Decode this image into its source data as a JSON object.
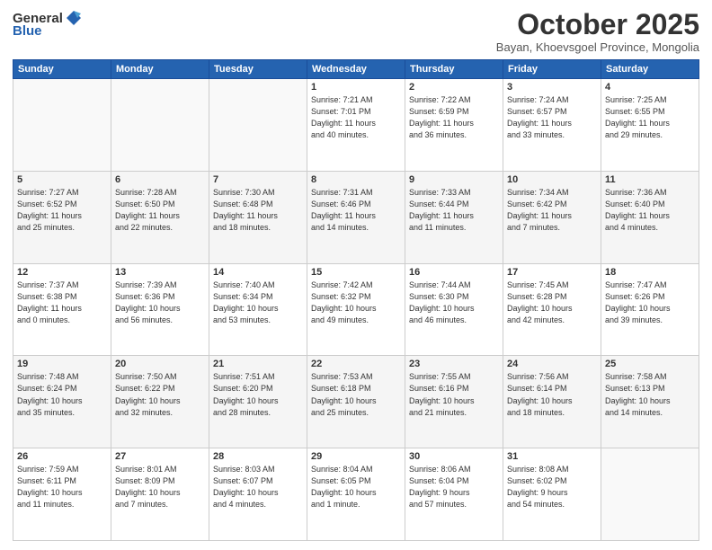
{
  "header": {
    "logo_general": "General",
    "logo_blue": "Blue",
    "month_title": "October 2025",
    "subtitle": "Bayan, Khoevsgoel Province, Mongolia"
  },
  "weekdays": [
    "Sunday",
    "Monday",
    "Tuesday",
    "Wednesday",
    "Thursday",
    "Friday",
    "Saturday"
  ],
  "weeks": [
    [
      {
        "day": "",
        "text": ""
      },
      {
        "day": "",
        "text": ""
      },
      {
        "day": "",
        "text": ""
      },
      {
        "day": "1",
        "text": "Sunrise: 7:21 AM\nSunset: 7:01 PM\nDaylight: 11 hours\nand 40 minutes."
      },
      {
        "day": "2",
        "text": "Sunrise: 7:22 AM\nSunset: 6:59 PM\nDaylight: 11 hours\nand 36 minutes."
      },
      {
        "day": "3",
        "text": "Sunrise: 7:24 AM\nSunset: 6:57 PM\nDaylight: 11 hours\nand 33 minutes."
      },
      {
        "day": "4",
        "text": "Sunrise: 7:25 AM\nSunset: 6:55 PM\nDaylight: 11 hours\nand 29 minutes."
      }
    ],
    [
      {
        "day": "5",
        "text": "Sunrise: 7:27 AM\nSunset: 6:52 PM\nDaylight: 11 hours\nand 25 minutes."
      },
      {
        "day": "6",
        "text": "Sunrise: 7:28 AM\nSunset: 6:50 PM\nDaylight: 11 hours\nand 22 minutes."
      },
      {
        "day": "7",
        "text": "Sunrise: 7:30 AM\nSunset: 6:48 PM\nDaylight: 11 hours\nand 18 minutes."
      },
      {
        "day": "8",
        "text": "Sunrise: 7:31 AM\nSunset: 6:46 PM\nDaylight: 11 hours\nand 14 minutes."
      },
      {
        "day": "9",
        "text": "Sunrise: 7:33 AM\nSunset: 6:44 PM\nDaylight: 11 hours\nand 11 minutes."
      },
      {
        "day": "10",
        "text": "Sunrise: 7:34 AM\nSunset: 6:42 PM\nDaylight: 11 hours\nand 7 minutes."
      },
      {
        "day": "11",
        "text": "Sunrise: 7:36 AM\nSunset: 6:40 PM\nDaylight: 11 hours\nand 4 minutes."
      }
    ],
    [
      {
        "day": "12",
        "text": "Sunrise: 7:37 AM\nSunset: 6:38 PM\nDaylight: 11 hours\nand 0 minutes."
      },
      {
        "day": "13",
        "text": "Sunrise: 7:39 AM\nSunset: 6:36 PM\nDaylight: 10 hours\nand 56 minutes."
      },
      {
        "day": "14",
        "text": "Sunrise: 7:40 AM\nSunset: 6:34 PM\nDaylight: 10 hours\nand 53 minutes."
      },
      {
        "day": "15",
        "text": "Sunrise: 7:42 AM\nSunset: 6:32 PM\nDaylight: 10 hours\nand 49 minutes."
      },
      {
        "day": "16",
        "text": "Sunrise: 7:44 AM\nSunset: 6:30 PM\nDaylight: 10 hours\nand 46 minutes."
      },
      {
        "day": "17",
        "text": "Sunrise: 7:45 AM\nSunset: 6:28 PM\nDaylight: 10 hours\nand 42 minutes."
      },
      {
        "day": "18",
        "text": "Sunrise: 7:47 AM\nSunset: 6:26 PM\nDaylight: 10 hours\nand 39 minutes."
      }
    ],
    [
      {
        "day": "19",
        "text": "Sunrise: 7:48 AM\nSunset: 6:24 PM\nDaylight: 10 hours\nand 35 minutes."
      },
      {
        "day": "20",
        "text": "Sunrise: 7:50 AM\nSunset: 6:22 PM\nDaylight: 10 hours\nand 32 minutes."
      },
      {
        "day": "21",
        "text": "Sunrise: 7:51 AM\nSunset: 6:20 PM\nDaylight: 10 hours\nand 28 minutes."
      },
      {
        "day": "22",
        "text": "Sunrise: 7:53 AM\nSunset: 6:18 PM\nDaylight: 10 hours\nand 25 minutes."
      },
      {
        "day": "23",
        "text": "Sunrise: 7:55 AM\nSunset: 6:16 PM\nDaylight: 10 hours\nand 21 minutes."
      },
      {
        "day": "24",
        "text": "Sunrise: 7:56 AM\nSunset: 6:14 PM\nDaylight: 10 hours\nand 18 minutes."
      },
      {
        "day": "25",
        "text": "Sunrise: 7:58 AM\nSunset: 6:13 PM\nDaylight: 10 hours\nand 14 minutes."
      }
    ],
    [
      {
        "day": "26",
        "text": "Sunrise: 7:59 AM\nSunset: 6:11 PM\nDaylight: 10 hours\nand 11 minutes."
      },
      {
        "day": "27",
        "text": "Sunrise: 8:01 AM\nSunset: 8:09 PM\nDaylight: 10 hours\nand 7 minutes."
      },
      {
        "day": "28",
        "text": "Sunrise: 8:03 AM\nSunset: 6:07 PM\nDaylight: 10 hours\nand 4 minutes."
      },
      {
        "day": "29",
        "text": "Sunrise: 8:04 AM\nSunset: 6:05 PM\nDaylight: 10 hours\nand 1 minute."
      },
      {
        "day": "30",
        "text": "Sunrise: 8:06 AM\nSunset: 6:04 PM\nDaylight: 9 hours\nand 57 minutes."
      },
      {
        "day": "31",
        "text": "Sunrise: 8:08 AM\nSunset: 6:02 PM\nDaylight: 9 hours\nand 54 minutes."
      },
      {
        "day": "",
        "text": ""
      }
    ]
  ]
}
